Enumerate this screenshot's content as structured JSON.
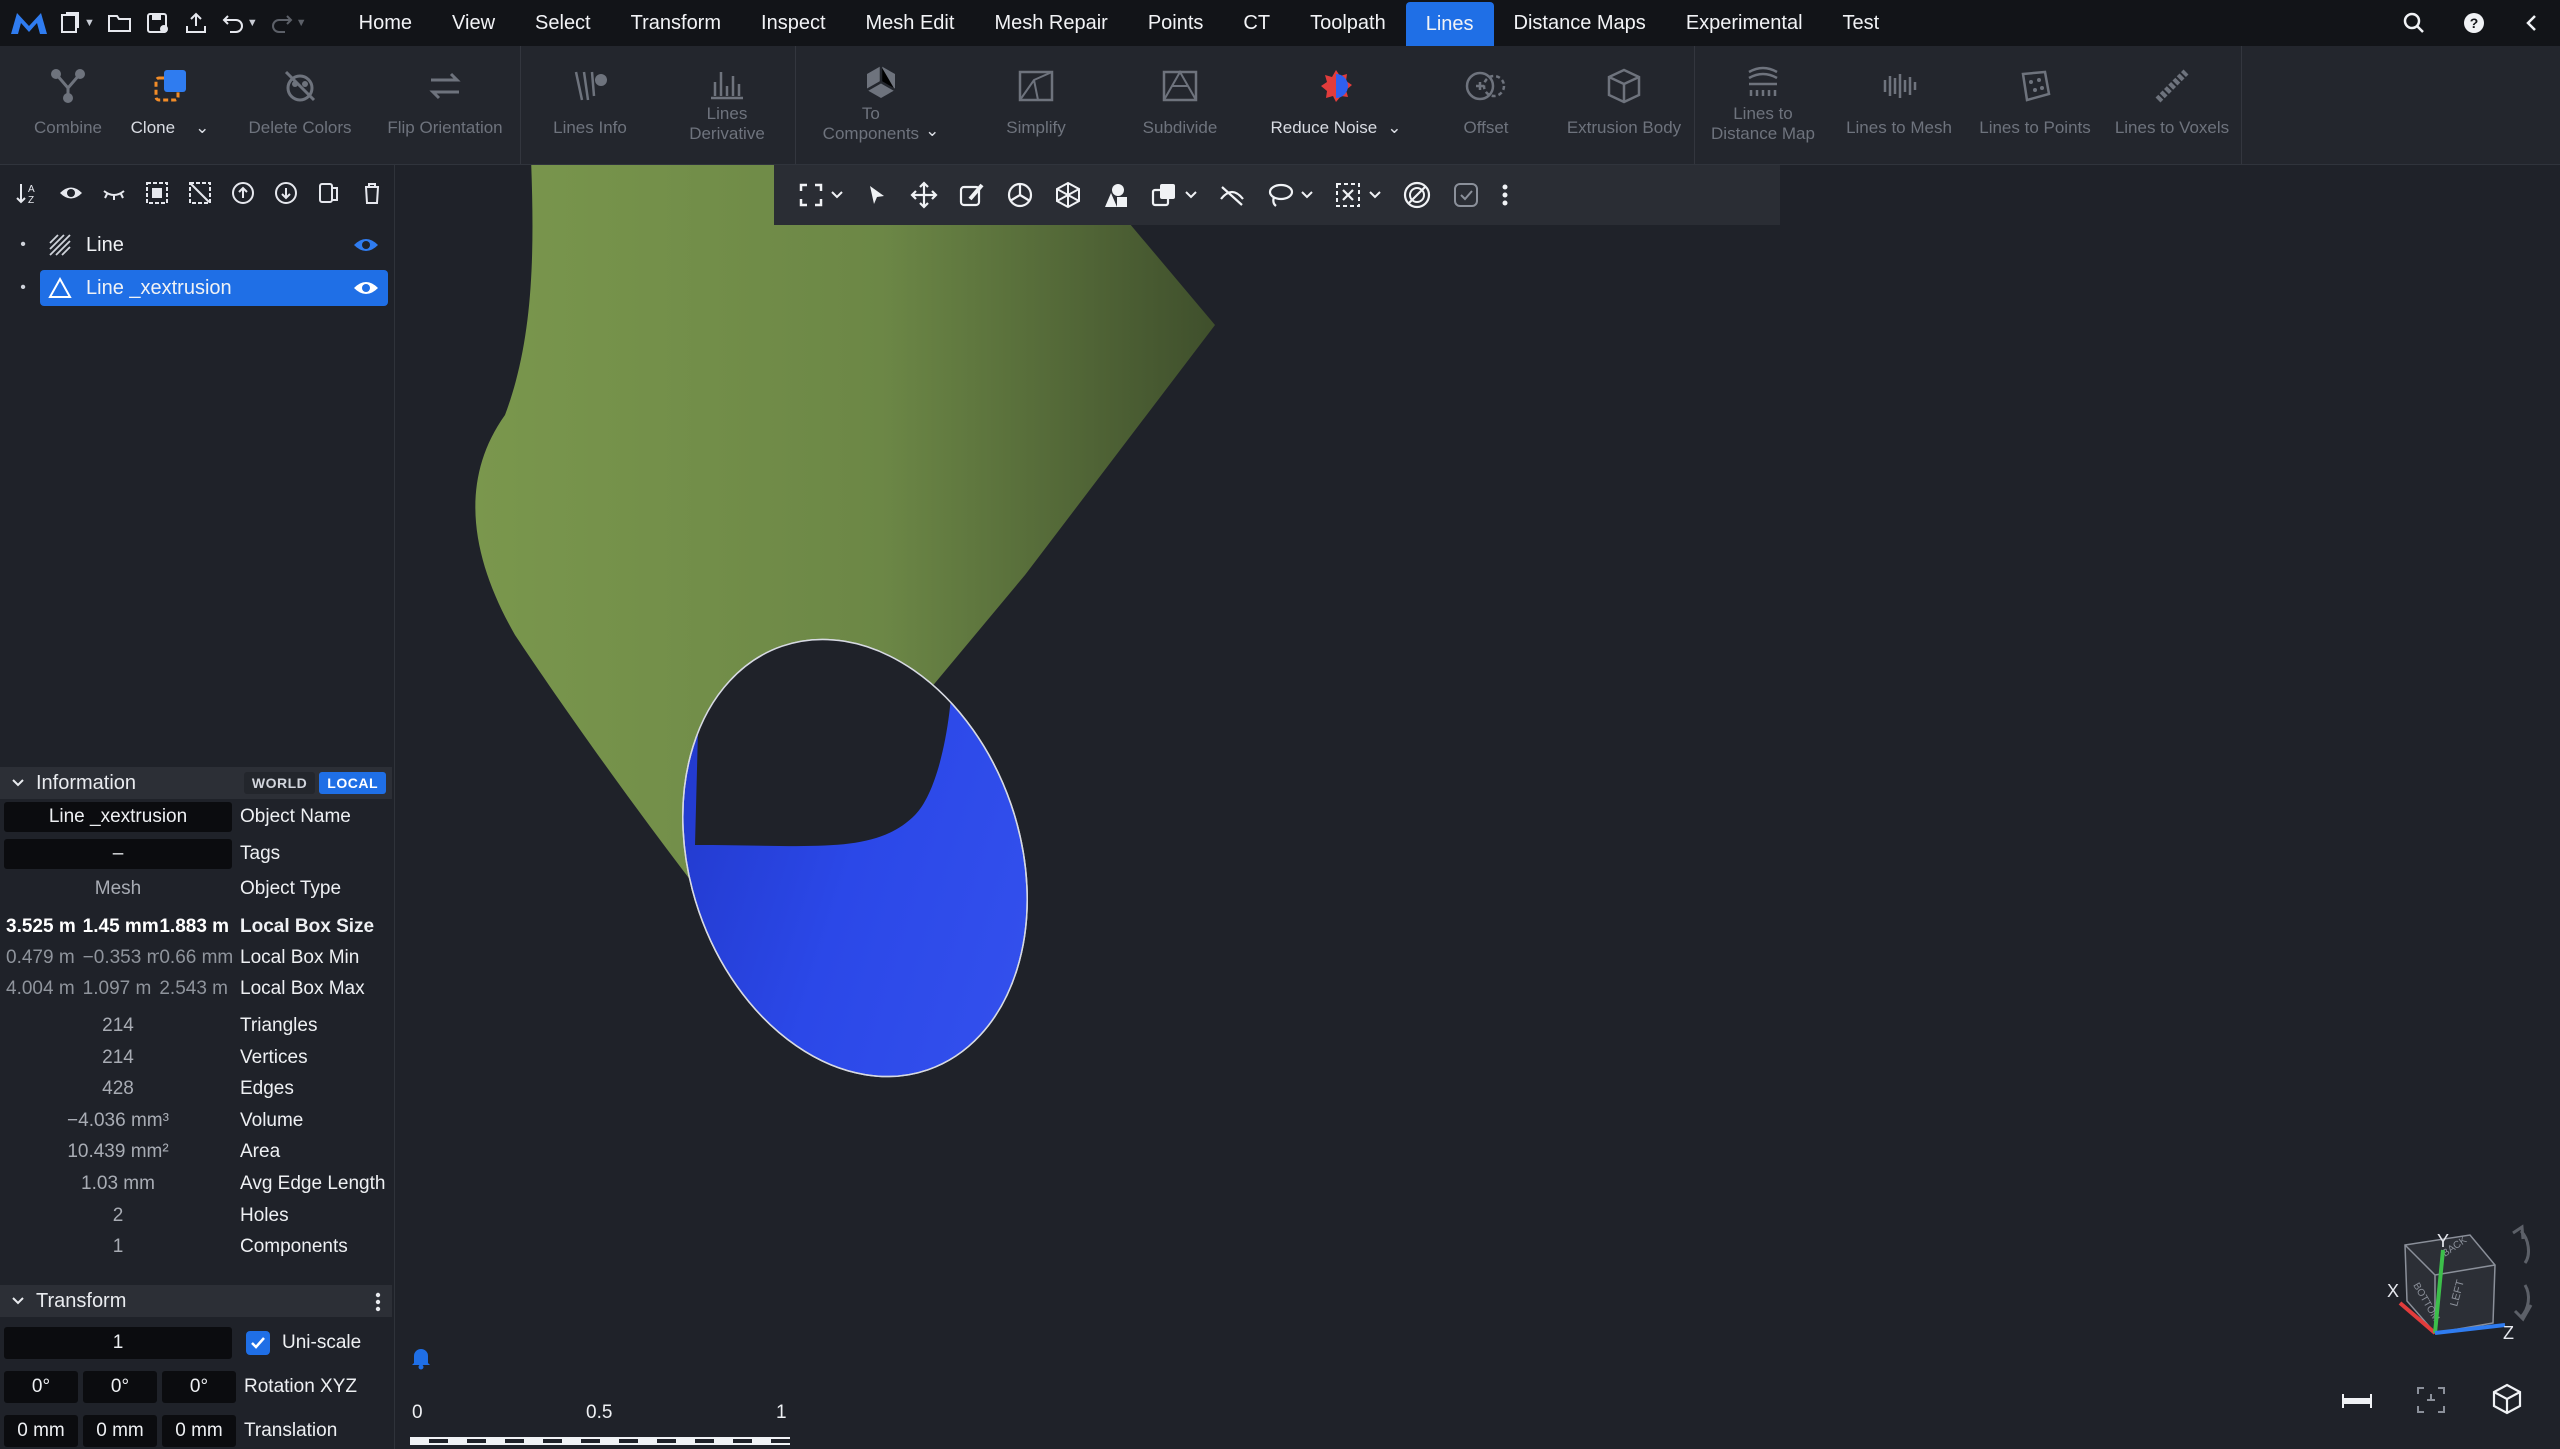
{
  "menu": {
    "tabs": [
      "Home",
      "View",
      "Select",
      "Transform",
      "Inspect",
      "Mesh Edit",
      "Mesh Repair",
      "Points",
      "CT",
      "Toolpath",
      "Lines",
      "Distance Maps",
      "Experimental",
      "Test"
    ],
    "active_tab": "Lines"
  },
  "ribbon": {
    "combine": "Combine",
    "clone": "Clone",
    "delete_colors": "Delete Colors",
    "flip_orientation": "Flip Orientation",
    "lines_info": "Lines Info",
    "lines_derivative_1": "Lines",
    "lines_derivative_2": "Derivative",
    "to_components_1": "To",
    "to_components_2": "Components",
    "simplify": "Simplify",
    "subdivide": "Subdivide",
    "reduce_noise": "Reduce Noise",
    "offset": "Offset",
    "extrusion_body": "Extrusion Body",
    "lines_to_distance_map_1": "Lines to",
    "lines_to_distance_map_2": "Distance Map",
    "lines_to_mesh": "Lines to Mesh",
    "lines_to_points": "Lines to Points",
    "lines_to_voxels": "Lines to Voxels"
  },
  "scene_tree": {
    "items": [
      {
        "name": "Line",
        "selected": false
      },
      {
        "name": "Line _xextrusion",
        "selected": true
      }
    ]
  },
  "information": {
    "title": "Information",
    "world": "WORLD",
    "local": "LOCAL",
    "object_name_value": "Line _xextrusion",
    "object_name_key": "Object Name",
    "tags_value": "–",
    "tags_key": "Tags",
    "object_type_value": "Mesh",
    "object_type_key": "Object Type",
    "box_size": [
      "3.525 m",
      "1.45 mm",
      "1.883 m"
    ],
    "box_size_key": "Local Box Size",
    "box_min": [
      "0.479 m",
      "−0.353 m",
      "0.66 mm"
    ],
    "box_min_key": "Local Box Min",
    "box_max": [
      "4.004 m",
      "1.097 m",
      "2.543 m"
    ],
    "box_max_key": "Local Box Max",
    "stats": [
      {
        "value": "214",
        "key": "Triangles"
      },
      {
        "value": "214",
        "key": "Vertices"
      },
      {
        "value": "428",
        "key": "Edges"
      },
      {
        "value": "−4.036 mm³",
        "key": "Volume"
      },
      {
        "value": "10.439 mm²",
        "key": "Area"
      },
      {
        "value": "1.03 mm",
        "key": "Avg Edge Length"
      },
      {
        "value": "2",
        "key": "Holes"
      },
      {
        "value": "1",
        "key": "Components"
      }
    ]
  },
  "transform": {
    "title": "Transform",
    "scale_value": "1",
    "uniscale_label": "Uni-scale",
    "rotation": [
      "0°",
      "0°",
      "0°"
    ],
    "rotation_label": "Rotation XYZ",
    "translation": [
      "0 mm",
      "0 mm",
      "0 mm"
    ],
    "translation_label": "Translation"
  },
  "ruler": {
    "labels": [
      "0",
      "0.5",
      "1"
    ]
  },
  "view_cube": {
    "x": "X",
    "y": "Y",
    "z": "Z",
    "face_top": "BACK",
    "face_left": "BOTTOM",
    "face_right": "LEFT"
  },
  "colors": {
    "accent": "#1f6fe6",
    "tube_outer": "#6f8a45",
    "tube_inner": "#2b48e8",
    "background": "#1f2229"
  }
}
